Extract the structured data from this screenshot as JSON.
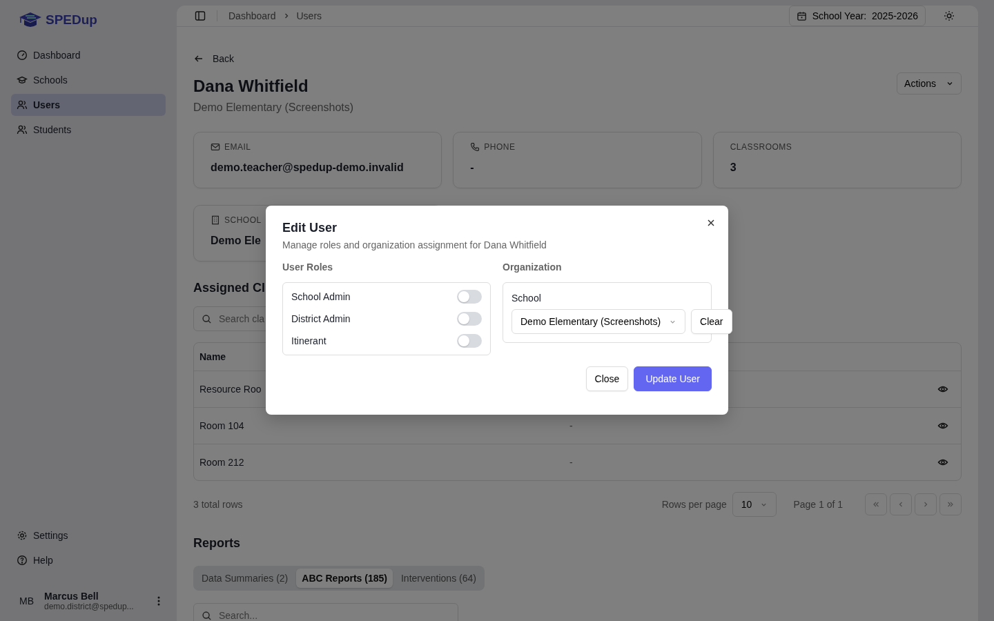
{
  "sidebar": {
    "logo": "SPEDup",
    "nav": [
      {
        "label": "Dashboard",
        "selected": false
      },
      {
        "label": "Schools",
        "selected": false
      },
      {
        "label": "Users",
        "selected": true
      },
      {
        "label": "Students",
        "selected": false
      }
    ],
    "footer_nav": [
      {
        "label": "Settings"
      },
      {
        "label": "Help"
      }
    ],
    "user": {
      "initials": "MB",
      "name": "Marcus Bell",
      "email": "demo.district@spedup..."
    }
  },
  "header": {
    "breadcrumbs": [
      "Dashboard",
      "Users"
    ],
    "school_year_label": "School Year:",
    "school_year": "2025-2026"
  },
  "page": {
    "back": "Back",
    "title": "Dana Whitfield",
    "subtitle": "Demo Elementary (Screenshots)",
    "actions": "Actions",
    "info_cards": [
      {
        "label": "EMAIL",
        "value": "demo.teacher@spedup-demo.invalid"
      },
      {
        "label": "PHONE",
        "value": "-"
      },
      {
        "label": "CLASSROOMS",
        "value": "3"
      },
      {
        "label": "SCHOOL",
        "value": "Demo Ele"
      }
    ]
  },
  "classrooms": {
    "title": "Assigned Cl",
    "search": {
      "placeholder": "Search cla"
    },
    "columns": [
      "Name"
    ],
    "rows": [
      {
        "cells": [
          "Resource Roo"
        ]
      },
      {
        "cells": [
          "Room 104",
          "-"
        ]
      },
      {
        "cells": [
          "Room 212",
          "-"
        ]
      }
    ],
    "total": "3 total rows",
    "rows_per_page_label": "Rows per page",
    "rows_per_page": "10",
    "page": "Page 1 of 1"
  },
  "reports": {
    "title": "Reports",
    "tabs": [
      {
        "label": "Data Summaries (2)",
        "selected": false
      },
      {
        "label": "ABC Reports (185)",
        "selected": true
      },
      {
        "label": "Interventions (64)",
        "selected": false
      }
    ],
    "search": {
      "placeholder": "Search..."
    }
  },
  "dialog": {
    "title": "Edit User",
    "description": "Manage roles and organization assignment for Dana Whitfield",
    "roles_label": "User Roles",
    "roles": [
      {
        "label": "School Admin",
        "on": false
      },
      {
        "label": "District Admin",
        "on": false
      },
      {
        "label": "Itinerant",
        "on": false
      }
    ],
    "org_label": "Organization",
    "school_label": "School",
    "school_value": "Demo Elementary (Screenshots)",
    "clear": "Clear",
    "close": "Close",
    "submit": "Update User"
  }
}
